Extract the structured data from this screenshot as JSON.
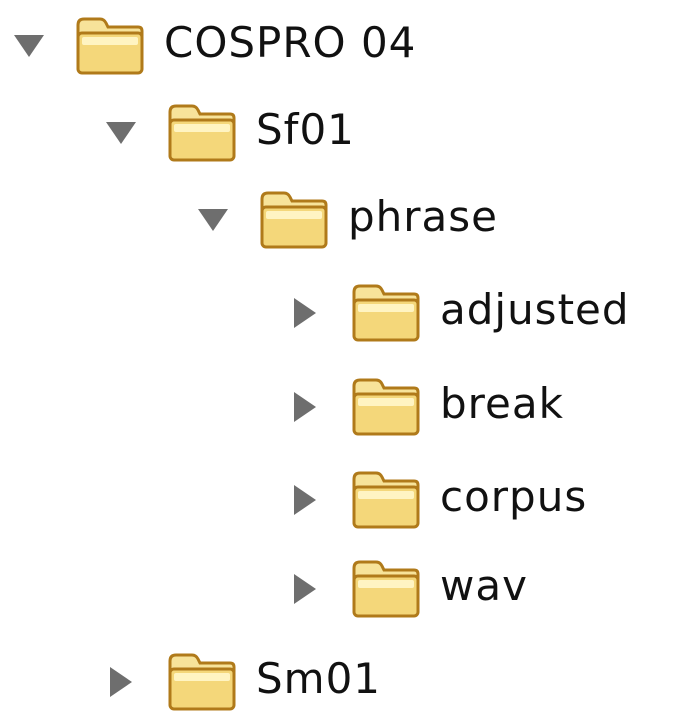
{
  "tree": {
    "nodes": [
      {
        "label": "COSPRO 04",
        "expanded": true,
        "depth": 0,
        "icon": "folder-icon"
      },
      {
        "label": "Sf01",
        "expanded": true,
        "depth": 1,
        "icon": "folder-icon"
      },
      {
        "label": "phrase",
        "expanded": true,
        "depth": 2,
        "icon": "folder-icon"
      },
      {
        "label": "adjusted",
        "expanded": false,
        "depth": 3,
        "icon": "folder-icon"
      },
      {
        "label": "break",
        "expanded": false,
        "depth": 3,
        "icon": "folder-icon"
      },
      {
        "label": "corpus",
        "expanded": false,
        "depth": 3,
        "icon": "folder-icon"
      },
      {
        "label": "wav",
        "expanded": false,
        "depth": 3,
        "icon": "folder-icon"
      },
      {
        "label": "Sm01",
        "expanded": false,
        "depth": 1,
        "icon": "folder-icon"
      }
    ]
  },
  "colors": {
    "toggle": "#6e6e6e",
    "folder_fill": "#f4d77a",
    "folder_light": "#fff4c2",
    "folder_outline": "#b07a1a",
    "text": "#111111"
  }
}
